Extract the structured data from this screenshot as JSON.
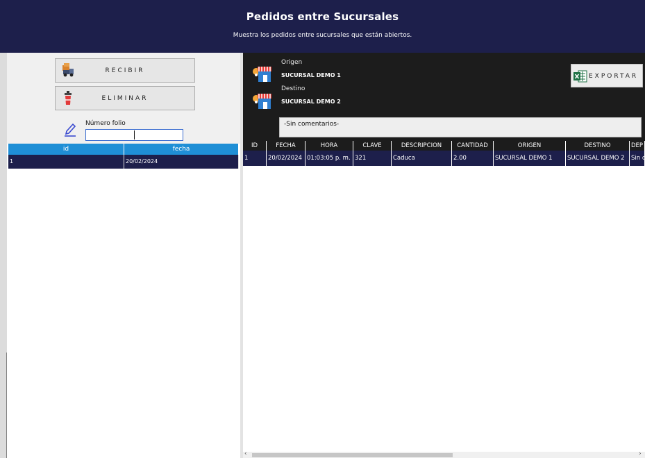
{
  "header": {
    "title": "Pedidos entre Sucursales",
    "subtitle": "Muestra los pedidos entre sucursales que están abiertos."
  },
  "left": {
    "recibir_label": "RECIBIR",
    "eliminar_label": "ELIMINAR",
    "folio_label": "Número folio",
    "folio_value": "",
    "grid": {
      "columns": [
        "id",
        "fecha"
      ],
      "rows": [
        [
          "1",
          "20/02/2024"
        ]
      ]
    }
  },
  "right": {
    "origen_label": "Origen",
    "origen_value": "SUCURSAL DEMO 1",
    "destino_label": "Destino",
    "destino_value": "SUCURSAL DEMO 2",
    "export_label": "EXPORTAR",
    "comments": "-Sin comentarios-",
    "grid": {
      "columns": [
        "ID",
        "FECHA",
        "HORA",
        "CLAVE",
        "DESCRIPCION",
        "CANTIDAD",
        "ORIGEN",
        "DESTINO",
        "DEP"
      ],
      "rows": [
        [
          "1",
          "20/02/2024",
          "01:03:05 p. m.",
          "321",
          "Caduca",
          "2.00",
          "SUCURSAL DEMO 1",
          "SUCURSAL DEMO 2",
          "Sin c"
        ]
      ]
    }
  },
  "colors": {
    "header_bg": "#1d1f4b",
    "accent_blue": "#1f8fd6",
    "row_selected": "#1d1f4b",
    "dark_panel": "#1c1c1c"
  },
  "icons": {
    "recibir": "truck-box-icon",
    "eliminar": "trash-cup-icon",
    "folio": "pencil-icon",
    "branch": "store-location-icon",
    "export": "excel-icon"
  }
}
